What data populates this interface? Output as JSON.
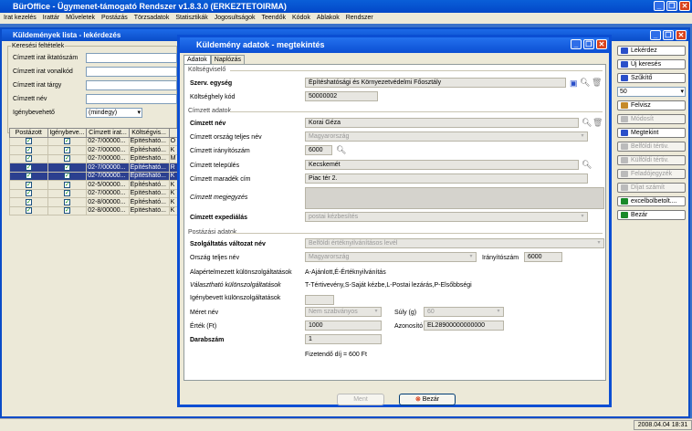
{
  "app": {
    "title": "BürOffice - Ügymenet-támogató Rendszer v1.8.3.0 (ERKEZTETOIRMA)",
    "status_time": "2008.04.04 18:31"
  },
  "menu": [
    "Irat kezelés",
    "Irattár",
    "Műveletek",
    "Postázás",
    "Törzsadatok",
    "Statisztikák",
    "Jogosultságok",
    "Teendők",
    "Kódok",
    "Ablakok",
    "Rendszer"
  ],
  "listwin": {
    "title": "Küldemények lista - lekérdezés",
    "search_group": "Keresési feltételek",
    "fields": [
      "Címzett irat iktatószám",
      "Címzett irat vonalkód",
      "Címzett irat tárgy",
      "Címzett név",
      "Igénybevehető"
    ],
    "igeny_value": "(mindegy)",
    "columns": [
      "Postázott",
      "Igénybeve...",
      "Címzett irat...",
      "Költségvis...",
      ""
    ],
    "rows": [
      {
        "c1": true,
        "c2": true,
        "irat": "02-7/00000...",
        "kolt": "Építésható...",
        "x": "Ő",
        "sel": false
      },
      {
        "c1": true,
        "c2": true,
        "irat": "02-7/00000...",
        "kolt": "Építésható...",
        "x": "K",
        "sel": false
      },
      {
        "c1": true,
        "c2": true,
        "irat": "02-7/00000...",
        "kolt": "Építésható...",
        "x": "M",
        "sel": false
      },
      {
        "c1": true,
        "c2": true,
        "irat": "02-7/00000...",
        "kolt": "Építésható...",
        "x": "R",
        "sel": true
      },
      {
        "c1": true,
        "c2": true,
        "irat": "02-7/00000...",
        "kolt": "Építésható...",
        "x": "K",
        "sel": true
      },
      {
        "c1": true,
        "c2": true,
        "irat": "02-5/00000...",
        "kolt": "Építésható...",
        "x": "K",
        "sel": false
      },
      {
        "c1": true,
        "c2": true,
        "irat": "02-7/00000...",
        "kolt": "Építésható...",
        "x": "K",
        "sel": false
      },
      {
        "c1": true,
        "c2": true,
        "irat": "02-8/00000...",
        "kolt": "Építésható...",
        "x": "K",
        "sel": false
      },
      {
        "c1": true,
        "c2": true,
        "irat": "02-8/00000...",
        "kolt": "Építésható...",
        "x": "K",
        "sel": false
      }
    ]
  },
  "rightpanel": {
    "buttons": [
      {
        "label": "Lekérdez",
        "dis": false,
        "color": "#2a4fc9"
      },
      {
        "label": "Új keresés",
        "dis": false,
        "color": "#2a4fc9"
      },
      {
        "label": "Szűkítő",
        "dis": false,
        "color": "#2a4fc9"
      },
      {
        "label": "Felvisz",
        "dis": false,
        "color": "#c58a2a"
      },
      {
        "label": "Módosít",
        "dis": true,
        "color": "#bbb"
      },
      {
        "label": "Megtekint",
        "dis": false,
        "color": "#2a4fc9"
      },
      {
        "label": "Belföldi tértiv.",
        "dis": true,
        "color": "#bbb"
      },
      {
        "label": "Külföldi tértiv.",
        "dis": true,
        "color": "#bbb"
      },
      {
        "label": "Feladójegyzék",
        "dis": true,
        "color": "#bbb"
      },
      {
        "label": "Díjat számít",
        "dis": true,
        "color": "#bbb"
      },
      {
        "label": "excelbolbetolt....",
        "dis": false,
        "color": "#1a8a2a"
      },
      {
        "label": "Bezár",
        "dis": false,
        "color": "#1a8a2a"
      }
    ],
    "pagesize": "50"
  },
  "dialog": {
    "title": "Küldemény adatok - megtekintés",
    "tabs": [
      "Adatok",
      "Naplózás"
    ],
    "sec_kolt": "Költségviselő",
    "szerv_label": "Szerv. egység",
    "szerv_value": "Építéshatósági és Környezetvédelmi Főosztály",
    "kolthely_label": "Költséghely kód",
    "kolthely_value": "50000002",
    "sec_cimzett": "Címzett adatok",
    "nev_label": "Címzett név",
    "nev_value": "Korai Géza",
    "orszag_label": "Címzett ország teljes név",
    "orszag_value": "Magyarország",
    "irsz_label": "Címzett irányítószám",
    "irsz_value": "6000",
    "telep_label": "Címzett település",
    "telep_value": "Kecskemét",
    "marad_label": "Címzett maradék cím",
    "marad_value": "Piac tér 2.",
    "megj_label": "Címzett megjegyzés",
    "exped_label": "Címzett expediálás",
    "exped_value": "postai kézbesítés",
    "sec_post": "Postázási adatok",
    "szolg_label": "Szolgáltatás változat név",
    "szolg_value": "Belföldi értéknyilvánításos levél",
    "ors2_label": "Ország teljes név",
    "ors2_value": "Magyarország",
    "irsz2_label": "Irányítószám",
    "irsz2_value": "6000",
    "alap_label": "Alapértelmezett különszolgáltatások",
    "alap_value": "A-Ajánlott,É-Értéknyilvánítás",
    "valaszt_label": "Választható különszolgáltatások",
    "valaszt_value": "T-Tértivevény,S-Saját kézbe,L-Postai lezárás,P-Elsőbbségi",
    "igeny_label": "Igénybevett különszolgáltatások",
    "meret_label": "Méret név",
    "meret_value": "Nem szabványos",
    "suly_label": "Súly (g)",
    "suly_value": "60",
    "ertek_label": "Érték (Ft)",
    "ertek_value": "1000",
    "azon_label": "Azonosító",
    "azon_value": "EL28900000000000",
    "darab_label": "Darabszám",
    "darab_value": "1",
    "fizet": "Fizetendő díj = 600 Ft",
    "ment": "Ment",
    "bezar": "Bezár"
  }
}
